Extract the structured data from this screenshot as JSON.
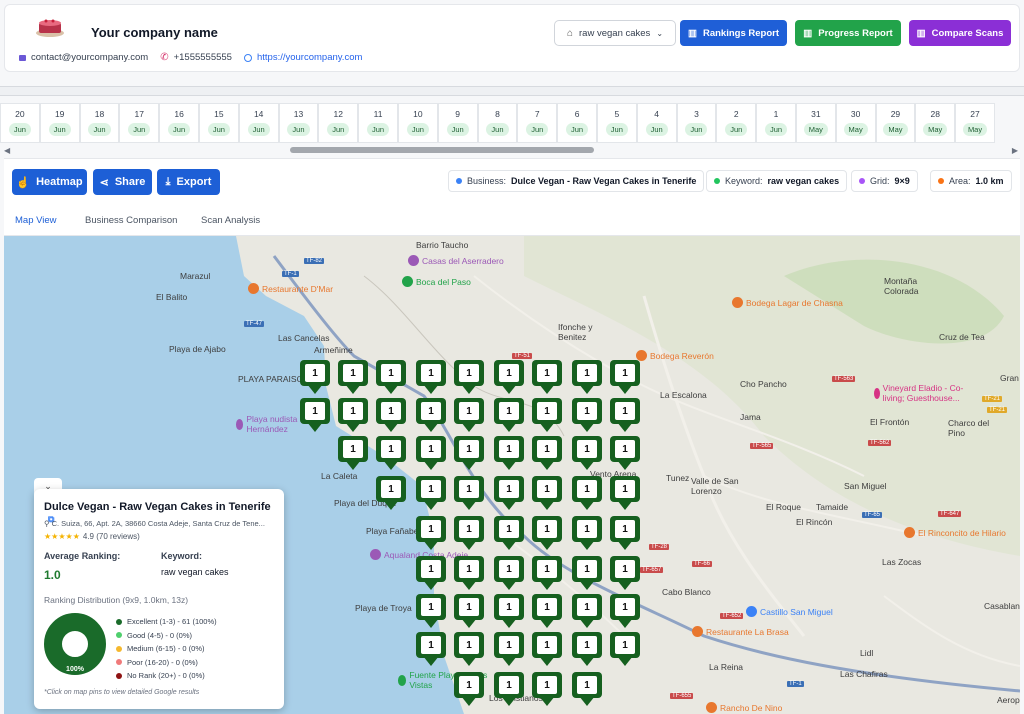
{
  "header": {
    "company_name": "Your company name",
    "email": "contact@yourcompany.com",
    "phone": "+1555555555",
    "website": "https://yourcompany.com",
    "keyword_select": "raw vegan cakes",
    "buttons": {
      "rankings": "Rankings Report",
      "progress": "Progress Report",
      "compare": "Compare Scans"
    },
    "colors": {
      "rankings": "#1f5fd7",
      "progress": "#22a34a",
      "compare": "#8b2fd6"
    }
  },
  "dates": [
    {
      "d": "20",
      "m": "Jun"
    },
    {
      "d": "19",
      "m": "Jun"
    },
    {
      "d": "18",
      "m": "Jun"
    },
    {
      "d": "17",
      "m": "Jun"
    },
    {
      "d": "16",
      "m": "Jun"
    },
    {
      "d": "15",
      "m": "Jun"
    },
    {
      "d": "14",
      "m": "Jun"
    },
    {
      "d": "13",
      "m": "Jun"
    },
    {
      "d": "12",
      "m": "Jun"
    },
    {
      "d": "11",
      "m": "Jun"
    },
    {
      "d": "10",
      "m": "Jun"
    },
    {
      "d": "9",
      "m": "Jun"
    },
    {
      "d": "8",
      "m": "Jun"
    },
    {
      "d": "7",
      "m": "Jun"
    },
    {
      "d": "6",
      "m": "Jun"
    },
    {
      "d": "5",
      "m": "Jun"
    },
    {
      "d": "4",
      "m": "Jun"
    },
    {
      "d": "3",
      "m": "Jun"
    },
    {
      "d": "2",
      "m": "Jun"
    },
    {
      "d": "1",
      "m": "Jun"
    },
    {
      "d": "31",
      "m": "May"
    },
    {
      "d": "30",
      "m": "May"
    },
    {
      "d": "29",
      "m": "May"
    },
    {
      "d": "28",
      "m": "May"
    },
    {
      "d": "27",
      "m": "May"
    }
  ],
  "toolbar": {
    "heatmap": "Heatmap",
    "share": "Share",
    "export": "Export",
    "business_label": "Business:",
    "business_value": "Dulce Vegan - Raw Vegan Cakes in Tenerife",
    "keyword_label": "Keyword:",
    "keyword_value": "raw vegan cakes",
    "grid_label": "Grid:",
    "grid_value": "9×9",
    "area_label": "Area:",
    "area_value": "1.0 km"
  },
  "tabs": [
    "Map View",
    "Business Comparison",
    "Scan Analysis"
  ],
  "map": {
    "labels": [
      "Barrio Taucho",
      "Marazul",
      "El Balito",
      "Las Cancelas",
      "Armeñime",
      "PLAYA PARAISO",
      "Playa de Ajabo",
      "La Caleta",
      "Ifonche y Benitez",
      "La Escalona",
      "Jama",
      "El Frontón",
      "Tunez",
      "Valle de San Lorenzo",
      "El Roque",
      "Tamaide",
      "El Rincón",
      "San Miguel",
      "Cabo Blanco",
      "Las Zocas",
      "La Reina",
      "Las Chafiras",
      "Cruz de Tea",
      "Montaña Colorada",
      "Charco del Pino",
      "Cho Pancho",
      "Casablanca",
      "Playa Fañabe",
      "Playa del Duque",
      "Playa de Troya",
      "Gran",
      "Aeropuerto",
      "Lidl",
      "Vento Arena",
      "Los Cristianos"
    ],
    "pois": [
      "Casas del Aserradero",
      "Restaurante D'Mar",
      "Boca del Paso",
      "Bodega Lagar de Chasna",
      "Bodega Reverón",
      "Vineyard Eladio - Co-living; Guesthouse...",
      "Playa nudista Diego Hernández",
      "Aqualand Costa Adeje",
      "Castillo San Miguel",
      "Restaurante La Brasa",
      "El Rinconcito de Hilario",
      "Rancho De Nino",
      "Fuente Playa de Las Vistas"
    ],
    "roads": [
      "TF-82",
      "TF-1",
      "TF-47",
      "TF-21",
      "TF-51",
      "TF-563",
      "TF-565",
      "TF-562",
      "TF-21",
      "TF-65",
      "TF-647",
      "TF-66",
      "TF-657",
      "TF-28",
      "TF-652",
      "TF-655",
      "TF-1"
    ],
    "pin_value": "1",
    "grid_rows": [
      [
        1,
        1,
        1,
        1,
        1,
        1,
        1,
        1,
        1
      ],
      [
        1,
        1,
        1,
        1,
        1,
        1,
        1,
        1,
        1
      ],
      [
        1,
        1,
        1,
        1,
        1,
        1,
        1,
        1
      ],
      [
        1,
        1,
        1,
        1,
        1,
        1,
        1
      ],
      [
        1,
        1,
        1,
        1,
        1,
        1
      ],
      [
        1,
        1,
        1,
        1,
        1,
        1
      ],
      [
        1,
        1,
        1,
        1,
        1,
        1
      ],
      [
        1,
        1,
        1,
        1,
        1,
        1
      ],
      [
        1,
        1,
        1,
        1
      ]
    ]
  },
  "card": {
    "name": "Dulce Vegan - Raw Vegan Cakes in Tenerife",
    "address": "C. Suiza, 66, Apt. 2A, 38660 Costa Adeje, Santa Cruz de Tene...",
    "stars": "★★★★★",
    "rating": "4.9 (70 reviews)",
    "avg_label": "Average Ranking:",
    "avg_value": "1.0",
    "keyword_label": "Keyword:",
    "keyword_value": "raw vegan cakes",
    "dist_title": "Ranking Distribution (9x9, 1.0km, 13z)",
    "donut_label": "100%",
    "donut_fraction": 1.0,
    "legend": [
      {
        "text": "Excellent (1-3) - 61 (100%)",
        "color": "#1a6b2a"
      },
      {
        "text": "Good (4-5) - 0 (0%)",
        "color": "#4fcf6d"
      },
      {
        "text": "Medium (6-15) - 0 (0%)",
        "color": "#f5b82e"
      },
      {
        "text": "Poor (16-20) - 0 (0%)",
        "color": "#f07a7a"
      },
      {
        "text": "No Rank (20+) - 0 (0%)",
        "color": "#8e1313"
      }
    ],
    "note": "*Click on map pins to view detailed Google results"
  }
}
